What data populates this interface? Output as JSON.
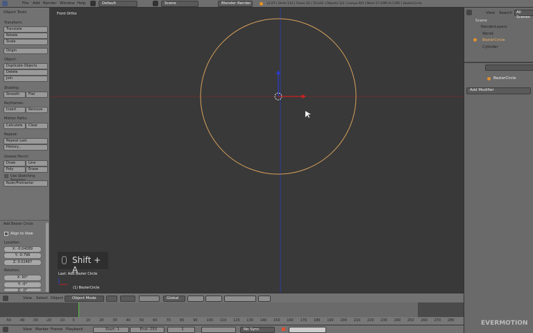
{
  "topbar": {
    "menus": [
      "File",
      "Add",
      "Render",
      "Window",
      "Help"
    ],
    "layout": "Default",
    "scene": "Scene",
    "engine": "Blender Render",
    "stats": "v2.67 | Verts:112 | Faces:32 | Tris:64 | Objects:1/2 | Lamps:0/0 | Mem:17.29M (0.11M) | BezierCircle"
  },
  "tools": {
    "title": "Object Tools",
    "transform": "Transform:",
    "translate": "Translate",
    "rotate": "Rotate",
    "scale": "Scale",
    "origin": "Origin",
    "object": "Object:",
    "duplicate": "Duplicate Objects",
    "delete": "Delete",
    "join": "Join",
    "shading": "Shading:",
    "smooth": "Smooth",
    "flat": "Flat",
    "keyframes": "Keyframes:",
    "insert": "Insert",
    "remove": "Remove",
    "motion": "Motion Paths:",
    "calculate": "Calculate",
    "clear": "Clear",
    "repeat": "Repeat:",
    "repeat_last": "Repeat Last",
    "history": "History...",
    "grease": "Grease Pencil:",
    "draw": "Draw",
    "line": "Line",
    "poly": "Poly",
    "erase": "Erase",
    "sketch": "Use Sketching Sessions",
    "ruler": "Ruler/Protractor"
  },
  "operator": {
    "title": "Add Bezier Circle",
    "align": "Align to View",
    "location": "Location:",
    "lx": "X: -0.04089",
    "ly": "Y: -0.796",
    "lz": "Z: 0.02487",
    "rotation": "Rotation:",
    "rx": "X: 90°",
    "ry": "Y: -0°",
    "rz": "Z: -0°"
  },
  "viewport": {
    "view_name": "Front Ortho",
    "shortcut": "Shift + A",
    "last_op": "Last: Add Bezier Circle",
    "object_label": "(1) BezierCircle",
    "colors": {
      "curve": "#d9a25a",
      "x_axis": "#c02020",
      "z_axis": "#2a3cc0"
    }
  },
  "vphead": {
    "menus": [
      "View",
      "Select",
      "Object"
    ],
    "mode": "Object Mode",
    "orientation": "Global"
  },
  "timeline": {
    "ticks": [
      "-50",
      "-40",
      "-30",
      "-20",
      "-10",
      "0",
      "10",
      "20",
      "30",
      "40",
      "50",
      "60",
      "70",
      "80",
      "90",
      "100",
      "110",
      "120",
      "130",
      "140",
      "150",
      "160",
      "170",
      "180",
      "190",
      "200",
      "210",
      "220",
      "230",
      "240",
      "250",
      "260",
      "270",
      "280"
    ],
    "current_frame_value": 1
  },
  "tlhead": {
    "menus": [
      "View",
      "Marker",
      "Frame",
      "Playback"
    ],
    "start": "Start: 1",
    "end": "End: 250",
    "frame": "1",
    "sync": "No Sync"
  },
  "outliner": {
    "view": "View",
    "search": "Search",
    "filter": "All Scenes",
    "items": [
      "Scene",
      "RenderLayers",
      "World",
      "BezierCircle",
      "Cylinder"
    ]
  },
  "properties": {
    "object": "BezierCircle",
    "add_modifier": "Add Modifier"
  },
  "watermark": "EVERMOTION"
}
